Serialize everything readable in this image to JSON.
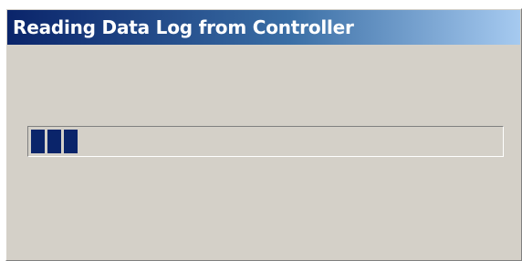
{
  "window": {
    "title": "Reading Data Log from Controller"
  },
  "progress": {
    "fraction": 0.11,
    "blocks_filled": 3,
    "bar_color": "#0a246a"
  },
  "colors": {
    "title_gradient_start": "#0a246a",
    "title_gradient_end": "#a6caf0",
    "dialog_background": "#d4d0c8"
  }
}
